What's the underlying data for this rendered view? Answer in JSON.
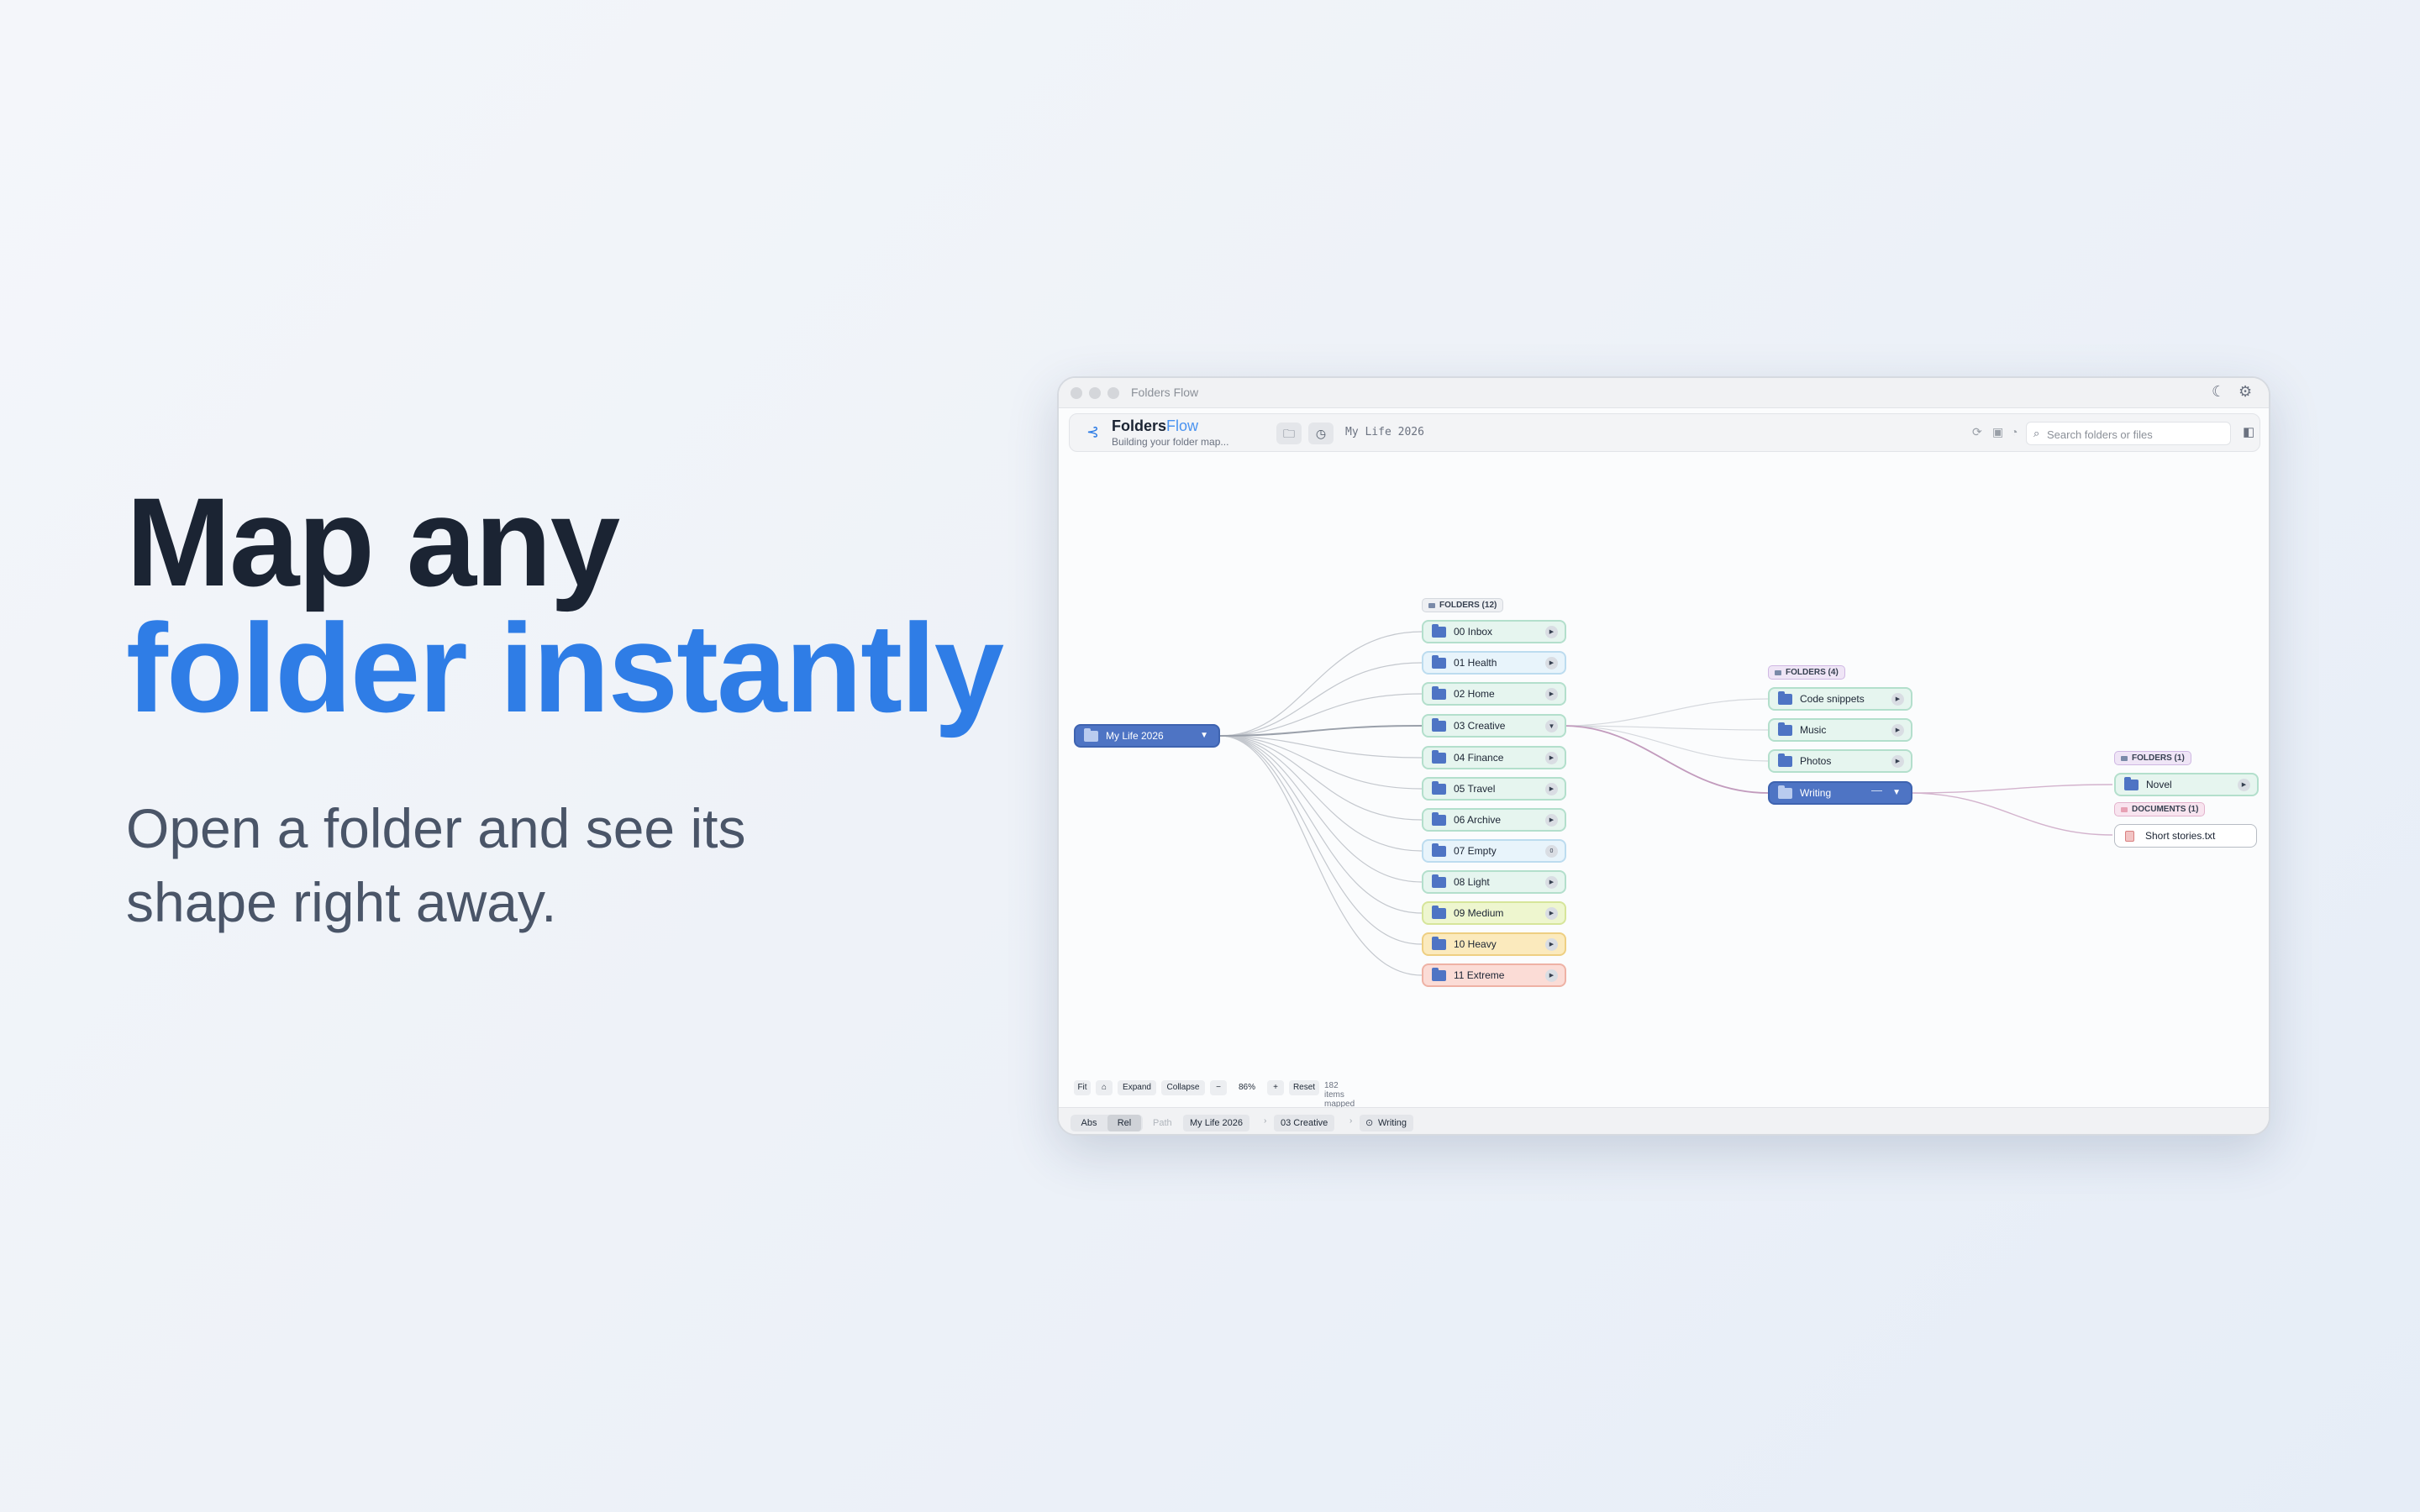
{
  "hero": {
    "line1": "Map any",
    "line2": "folder instantly",
    "subtitle": "Open a folder and see its shape right away."
  },
  "window": {
    "title": "Folders Flow",
    "moon_icon": "moon-icon",
    "settings_icon": "gear-icon"
  },
  "toolbar": {
    "brand_main": "Folders",
    "brand_accent": "Flow",
    "brand_sub": "Building your folder map...",
    "path": "My Life 2026",
    "search_placeholder": "Search folders or files"
  },
  "map": {
    "root": "My Life 2026",
    "level1_group": "FOLDERS (12)",
    "level1": [
      {
        "label": "00 Inbox",
        "tone": "green"
      },
      {
        "label": "01 Health",
        "tone": "blue"
      },
      {
        "label": "02 Home",
        "tone": "green"
      },
      {
        "label": "03 Creative",
        "tone": "green"
      },
      {
        "label": "04 Finance",
        "tone": "green"
      },
      {
        "label": "05 Travel",
        "tone": "green"
      },
      {
        "label": "06 Archive",
        "tone": "green"
      },
      {
        "label": "07 Empty",
        "tone": "blue",
        "badge": "0"
      },
      {
        "label": "08 Light",
        "tone": "green"
      },
      {
        "label": "09 Medium",
        "tone": "yellow"
      },
      {
        "label": "10 Heavy",
        "tone": "orange"
      },
      {
        "label": "11 Extreme",
        "tone": "red"
      }
    ],
    "level2_group": "FOLDERS (4)",
    "level2": [
      "Code snippets",
      "Music",
      "Photos",
      "Writing"
    ],
    "level3_folder_group": "FOLDERS (1)",
    "level3_folder": "Novel",
    "level3_doc_group": "DOCUMENTS (1)",
    "level3_doc": "Short stories.txt",
    "colors": {
      "accent": "#4e74c4",
      "brand": "#2f7de6"
    }
  },
  "controls": {
    "fit": "Fit",
    "expand": "Expand",
    "collapse": "Collapse",
    "minus": "−",
    "zoom": "86%",
    "plus": "+",
    "reset": "Reset",
    "count": "182 items mapped"
  },
  "footer": {
    "abs": "Abs",
    "rel": "Rel",
    "path_label": "Path",
    "crumbs": [
      "My Life 2026",
      "03 Creative",
      "Writing"
    ]
  }
}
